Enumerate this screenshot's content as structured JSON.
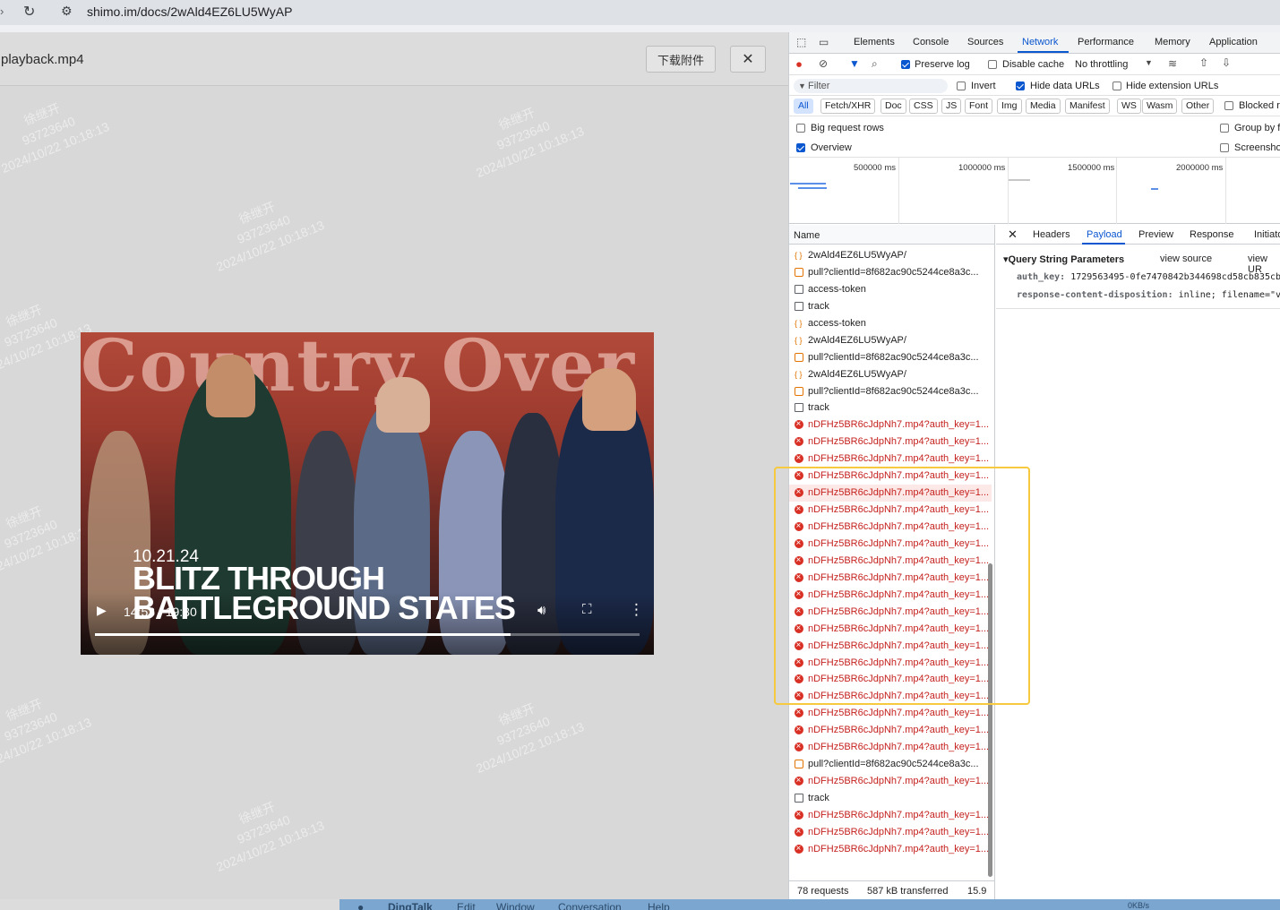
{
  "browser": {
    "url": "shimo.im/docs/2wAld4EZ6LU5WyAP"
  },
  "preview": {
    "file_name": "playback.mp4",
    "download_label": "下载附件",
    "close_glyph": "✕",
    "watermark": {
      "name": "徐继开",
      "id": "93723640",
      "timestamp": "2024/10/22 10:18:13"
    }
  },
  "video": {
    "banner_text": "Country Over",
    "date_caption": "10.21.24",
    "headline_line1": "BLITZ THROUGH",
    "headline_line2": "BATTLEGROUND STATES",
    "current_time": "14:53",
    "duration": "19:30",
    "time_display": "14:53 / 19:30",
    "progress_fraction": 0.7636
  },
  "dock": {
    "app": "DingTalk",
    "menus": [
      "Edit",
      "Window",
      "Conversation",
      "Help"
    ],
    "net_speed": "0KB/s"
  },
  "devtools": {
    "tabs": [
      "Elements",
      "Console",
      "Sources",
      "Network",
      "Performance",
      "Memory",
      "Application"
    ],
    "active_tab": "Network",
    "toolbar": {
      "preserve_log": "Preserve log",
      "disable_cache": "Disable cache",
      "throttling": "No throttling"
    },
    "filter": {
      "placeholder": "Filter",
      "invert": "Invert",
      "hide_data_urls": "Hide data URLs",
      "hide_extension_urls": "Hide extension URLs"
    },
    "type_filters": [
      "All",
      "Fetch/XHR",
      "Doc",
      "CSS",
      "JS",
      "Font",
      "Img",
      "Media",
      "Manifest",
      "WS",
      "Wasm",
      "Other"
    ],
    "blocked_label": "Blocked r",
    "settings": {
      "big_request_rows": "Big request rows",
      "overview": "Overview",
      "group_by": "Group by f",
      "screenshots": "Screensho"
    },
    "overview_ticks": [
      "500000 ms",
      "1000000 ms",
      "1500000 ms",
      "2000000 ms"
    ],
    "name_header": "Name",
    "requests": [
      {
        "name": "2wAld4EZ6LU5WyAP/",
        "kind": "api"
      },
      {
        "name": "pull?clientId=8f682ac90c5244ce8a3c...",
        "kind": "js"
      },
      {
        "name": "access-token",
        "kind": "doc"
      },
      {
        "name": "track",
        "kind": "doc"
      },
      {
        "name": "access-token",
        "kind": "api"
      },
      {
        "name": "2wAld4EZ6LU5WyAP/",
        "kind": "api"
      },
      {
        "name": "pull?clientId=8f682ac90c5244ce8a3c...",
        "kind": "js"
      },
      {
        "name": "2wAld4EZ6LU5WyAP/",
        "kind": "api"
      },
      {
        "name": "pull?clientId=8f682ac90c5244ce8a3c...",
        "kind": "js"
      },
      {
        "name": "track",
        "kind": "doc"
      },
      {
        "name": "nDFHz5BR6cJdpNh7.mp4?auth_key=1...",
        "kind": "err"
      },
      {
        "name": "nDFHz5BR6cJdpNh7.mp4?auth_key=1...",
        "kind": "err"
      },
      {
        "name": "nDFHz5BR6cJdpNh7.mp4?auth_key=1...",
        "kind": "err"
      },
      {
        "name": "nDFHz5BR6cJdpNh7.mp4?auth_key=1...",
        "kind": "err"
      },
      {
        "name": "nDFHz5BR6cJdpNh7.mp4?auth_key=1...",
        "kind": "err",
        "selected": true
      },
      {
        "name": "nDFHz5BR6cJdpNh7.mp4?auth_key=1...",
        "kind": "err"
      },
      {
        "name": "nDFHz5BR6cJdpNh7.mp4?auth_key=1...",
        "kind": "err"
      },
      {
        "name": "nDFHz5BR6cJdpNh7.mp4?auth_key=1...",
        "kind": "err"
      },
      {
        "name": "nDFHz5BR6cJdpNh7.mp4?auth_key=1...",
        "kind": "err"
      },
      {
        "name": "nDFHz5BR6cJdpNh7.mp4?auth_key=1...",
        "kind": "err"
      },
      {
        "name": "nDFHz5BR6cJdpNh7.mp4?auth_key=1...",
        "kind": "err"
      },
      {
        "name": "nDFHz5BR6cJdpNh7.mp4?auth_key=1...",
        "kind": "err"
      },
      {
        "name": "nDFHz5BR6cJdpNh7.mp4?auth_key=1...",
        "kind": "err"
      },
      {
        "name": "nDFHz5BR6cJdpNh7.mp4?auth_key=1...",
        "kind": "err"
      },
      {
        "name": "nDFHz5BR6cJdpNh7.mp4?auth_key=1...",
        "kind": "err"
      },
      {
        "name": "nDFHz5BR6cJdpNh7.mp4?auth_key=1...",
        "kind": "err"
      },
      {
        "name": "nDFHz5BR6cJdpNh7.mp4?auth_key=1...",
        "kind": "err"
      },
      {
        "name": "nDFHz5BR6cJdpNh7.mp4?auth_key=1...",
        "kind": "err"
      },
      {
        "name": "nDFHz5BR6cJdpNh7.mp4?auth_key=1...",
        "kind": "err"
      },
      {
        "name": "nDFHz5BR6cJdpNh7.mp4?auth_key=1...",
        "kind": "err"
      },
      {
        "name": "pull?clientId=8f682ac90c5244ce8a3c...",
        "kind": "js"
      },
      {
        "name": "nDFHz5BR6cJdpNh7.mp4?auth_key=1...",
        "kind": "err"
      },
      {
        "name": "track",
        "kind": "doc"
      },
      {
        "name": "nDFHz5BR6cJdpNh7.mp4?auth_key=1...",
        "kind": "err"
      },
      {
        "name": "nDFHz5BR6cJdpNh7.mp4?auth_key=1...",
        "kind": "err"
      },
      {
        "name": "nDFHz5BR6cJdpNh7.mp4?auth_key=1...",
        "kind": "err"
      }
    ],
    "status": {
      "requests": "78 requests",
      "transferred": "587 kB transferred",
      "resources": "15.9"
    },
    "detail_tabs": [
      "Headers",
      "Payload",
      "Preview",
      "Response",
      "Initiato"
    ],
    "active_detail_tab": "Payload",
    "payload": {
      "section": "Query String Parameters",
      "view_source": "view source",
      "view_url": "view UR",
      "params": [
        {
          "key": "auth_key:",
          "value": "1729563495-0fe7470842b344698cd58cb835cb"
        },
        {
          "key": "response-content-disposition:",
          "value": "inline; filename=\"vic"
        }
      ]
    }
  },
  "colors": {
    "accent": "#0b57d0",
    "error": "#c5221f",
    "highlight": "#f6c93e"
  }
}
